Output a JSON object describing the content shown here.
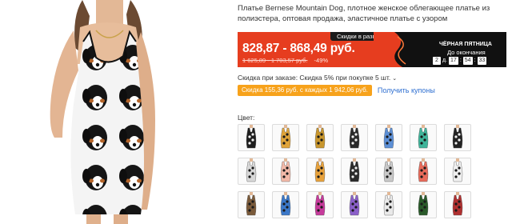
{
  "product": {
    "title": "Платье Bernese Mountain Dog, плотное женское облегающее платье из полиэстера, оптовая продажа, эластичное платье с узором"
  },
  "deal": {
    "badge": "Скидки в разгаре!",
    "price_range": "828,87 - 868,49 руб.",
    "old_price": "1 625,89 - 1 703,57 руб.",
    "discount_percent": "-49%",
    "promo_title": "ЧЁРНАЯ ПЯТНИЦА",
    "countdown_label": "До окончания",
    "timer": {
      "days": "2",
      "day_suffix": "д.",
      "hours": "17",
      "minutes": "54",
      "seconds": "33"
    }
  },
  "order_discount": {
    "text": "Скидка при заказе: Скидка 5% при покупке 5 шт.",
    "chevron_icon": "chevron-down-icon"
  },
  "coupon": {
    "pill": "Скидка 155,36 руб. с каждых 1 942,06 руб.",
    "link": "Получить купоны"
  },
  "colors": {
    "label": "Цвет:",
    "swatch_colors": [
      "#1e1e1e",
      "#e0a43a",
      "#c8962d",
      "#2a2a2a",
      "#5c8fd6",
      "#3fb49a",
      "#222222",
      "#d8d8d8",
      "#f3b9a8",
      "#e8a23c",
      "#2b2b2b",
      "#c9c9c9",
      "#e86a5a",
      "#f0f0f0",
      "#7a5a3a",
      "#3b78c9",
      "#c63a9b",
      "#8a5fc9",
      "#e9e9e9",
      "#2a5a2a",
      "#b03030"
    ]
  },
  "brand_colors": {
    "deal_red": "#e63d1f",
    "coupon_orange": "#f7a21b",
    "link_blue": "#2e6fd1"
  }
}
